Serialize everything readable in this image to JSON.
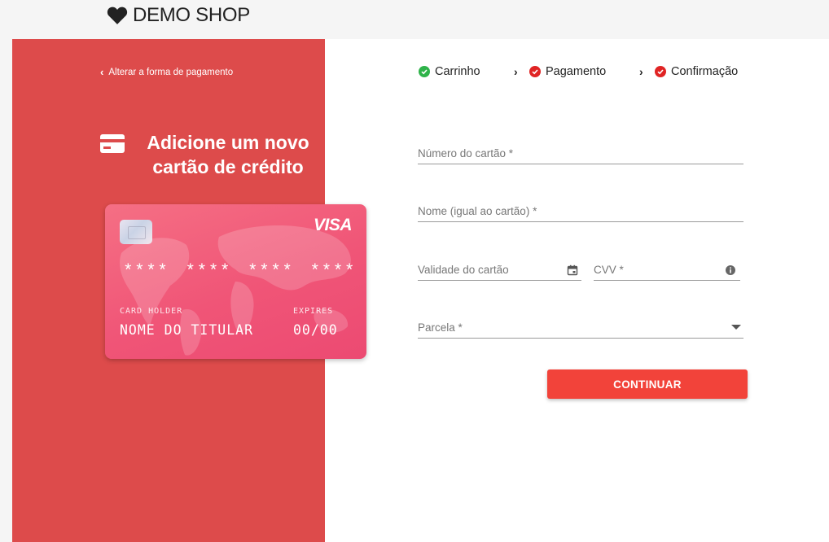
{
  "header": {
    "logo_text": "DEMO SHOP"
  },
  "left_panel": {
    "back_link": "Alterar a forma de pagamento",
    "title": "Adicione um novo cartão de crédito",
    "card": {
      "brand": "VISA",
      "number_mask": "**** **** **** ****",
      "holder_label": "CARD HOLDER",
      "holder_value": "NOME DO TITULAR",
      "expires_label": "EXPIRES",
      "expires_value": "00/00"
    }
  },
  "steps": [
    {
      "label": "Carrinho",
      "status": "done",
      "color": "#2fb34a"
    },
    {
      "label": "Pagamento",
      "status": "error",
      "color": "#e02424"
    },
    {
      "label": "Confirmação",
      "status": "error",
      "color": "#e02424"
    }
  ],
  "form": {
    "card_number_placeholder": "Número do cartão *",
    "name_placeholder": "Nome (igual ao cartão) *",
    "expiry_placeholder": "Validade do cartão",
    "cvv_placeholder": "CVV *",
    "installments_placeholder": "Parcela *",
    "continue_label": "CONTINUAR"
  },
  "colors": {
    "panel_red": "#dd4b4b",
    "button_red": "#f2433a",
    "card_pink": "#f05577"
  },
  "icons": [
    "heart-icon",
    "chevron-left-icon",
    "credit-card-icon",
    "check-circle-icon",
    "chevron-right-icon",
    "calendar-icon",
    "info-icon",
    "dropdown-arrow-icon"
  ]
}
